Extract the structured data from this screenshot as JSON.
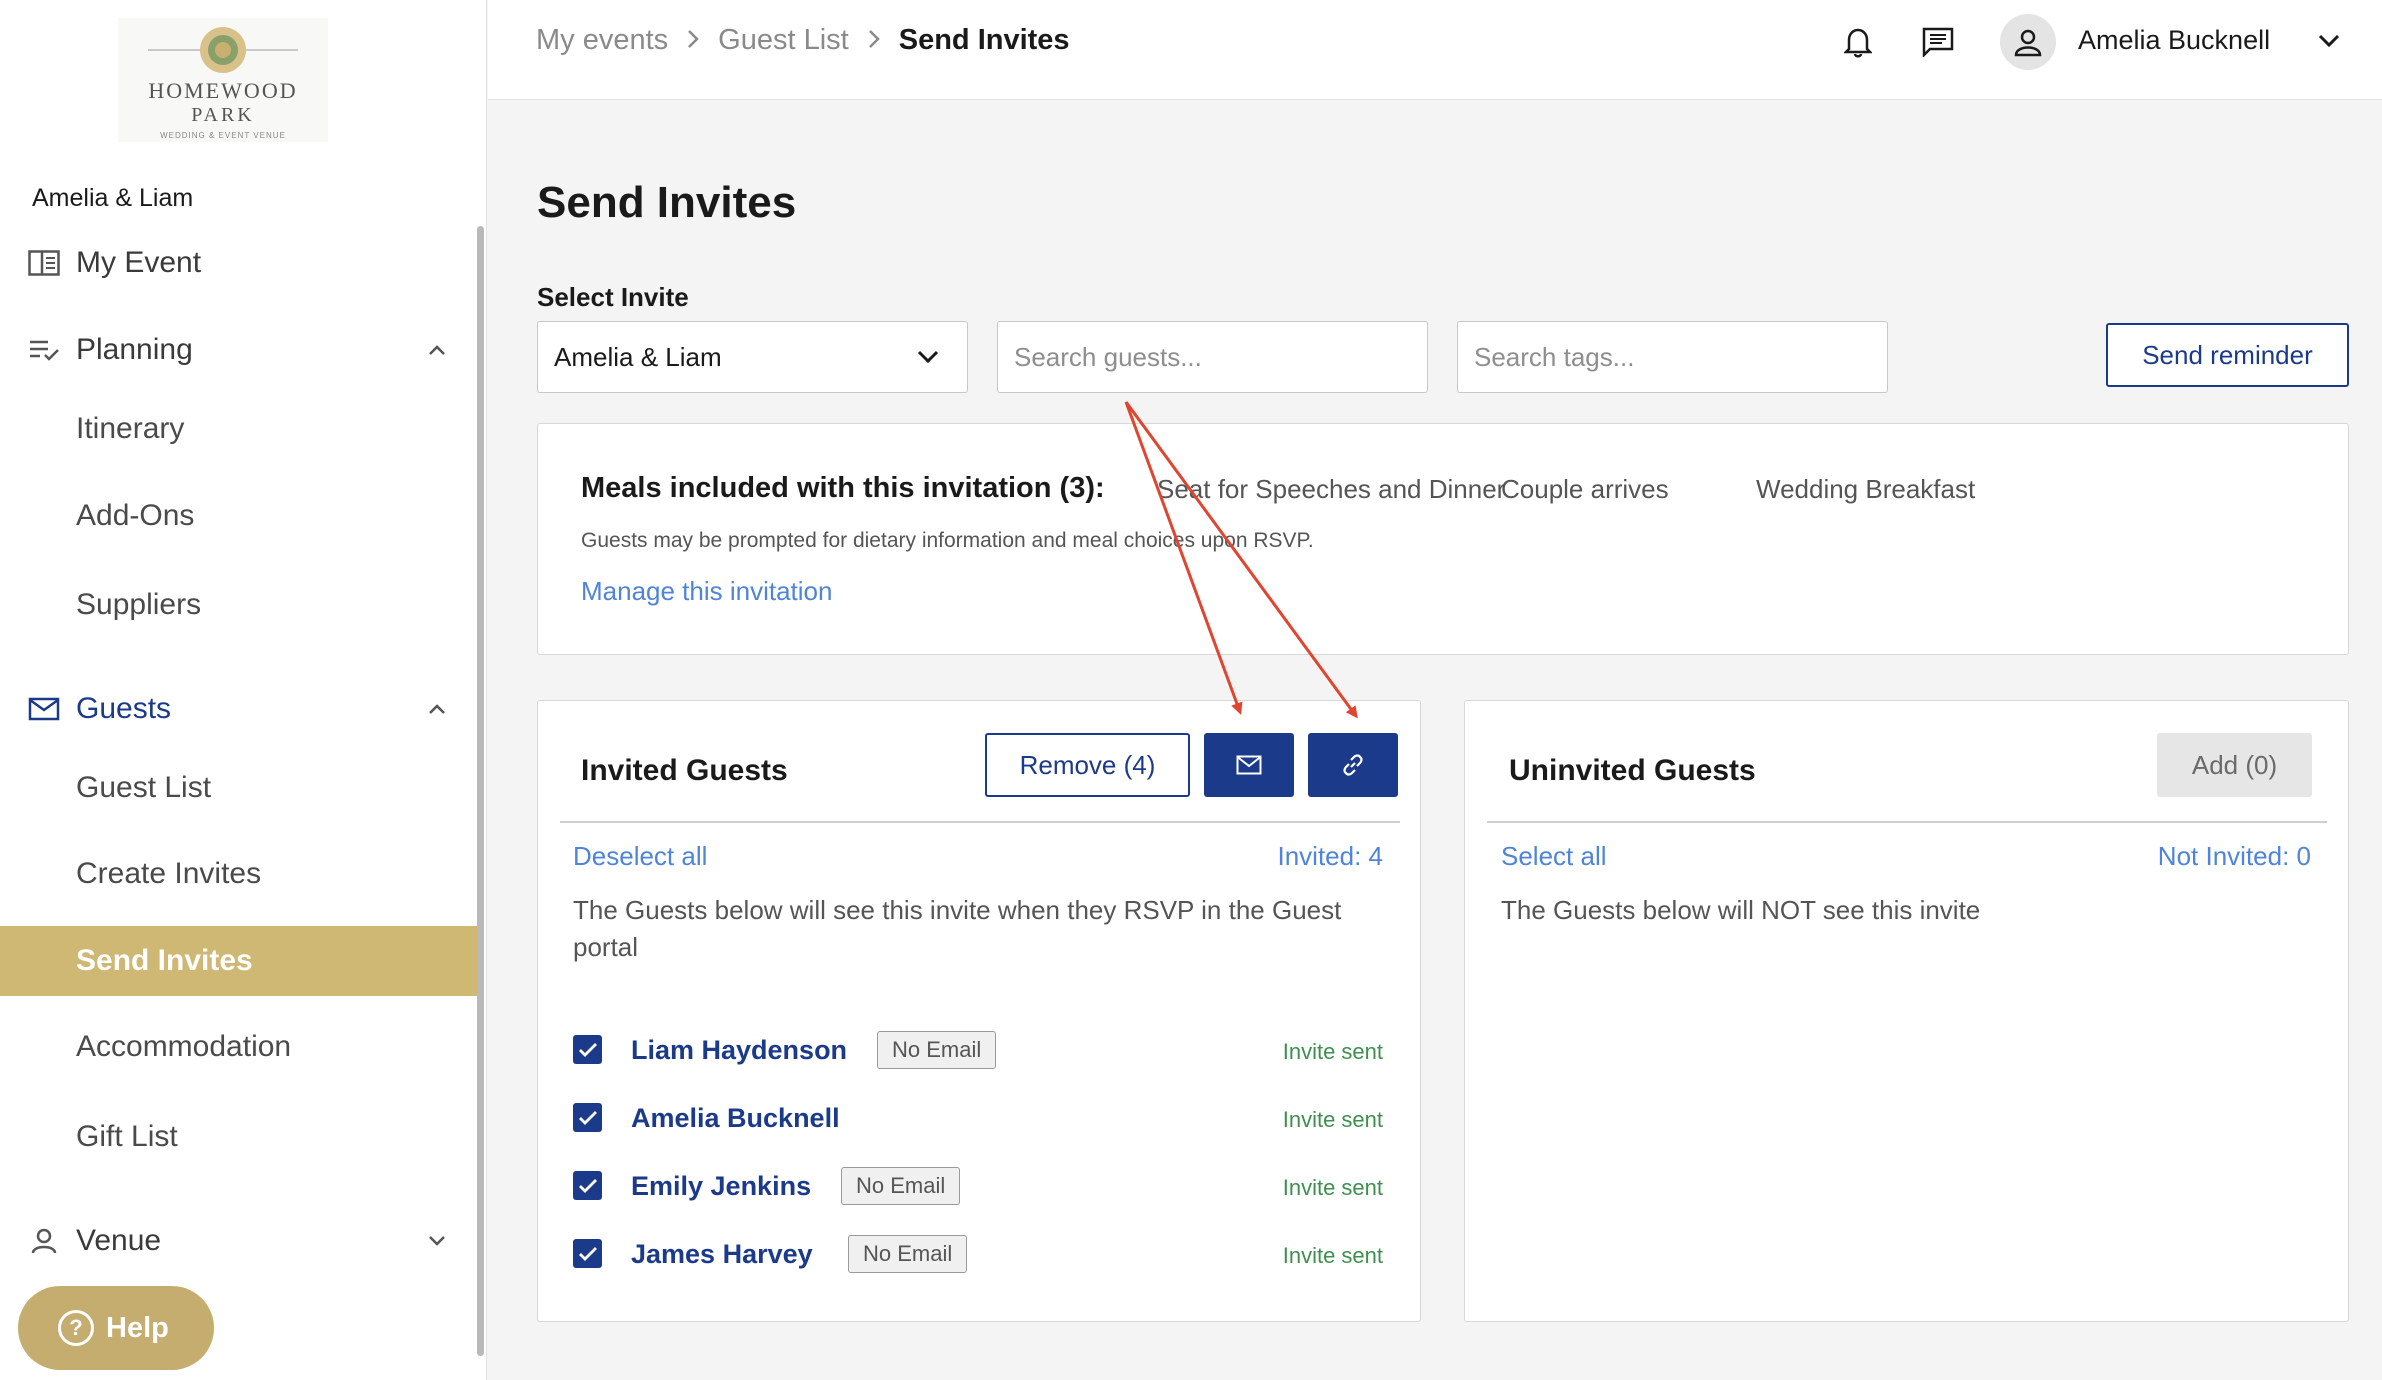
{
  "brand": {
    "logo_line1": "HOMEWOOD",
    "logo_line2": "PARK",
    "logo_line3": "WEDDING & EVENT VENUE"
  },
  "sidebar": {
    "event_name": "Amelia & Liam",
    "items": [
      {
        "label": "My Event",
        "icon": "book-icon"
      },
      {
        "label": "Planning",
        "icon": "checklist-icon"
      },
      {
        "label": "Itinerary"
      },
      {
        "label": "Add-Ons"
      },
      {
        "label": "Suppliers"
      },
      {
        "label": "Guests",
        "icon": "mail-icon"
      },
      {
        "label": "Guest List"
      },
      {
        "label": "Create Invites"
      },
      {
        "label": "Send Invites",
        "active": true
      },
      {
        "label": "Accommodation"
      },
      {
        "label": "Gift List"
      },
      {
        "label": "Venue",
        "icon": "person-icon"
      }
    ],
    "help_label": "Help"
  },
  "topbar": {
    "breadcrumbs": [
      "My events",
      "Guest List",
      "Send Invites"
    ],
    "user_name": "Amelia Bucknell"
  },
  "main": {
    "title": "Send Invites",
    "select_label": "Select Invite",
    "select_value": "Amelia & Liam",
    "search_guests_placeholder": "Search guests...",
    "search_tags_placeholder": "Search tags...",
    "send_reminder_label": "Send reminder"
  },
  "meals": {
    "title": "Meals included with this invitation (3):",
    "tags": [
      "Seat for Speeches and Dinner",
      "Couple arrives",
      "Wedding Breakfast"
    ],
    "note": "Guests may be prompted for dietary information and meal choices upon RSVP.",
    "manage_link": "Manage this invitation"
  },
  "invited": {
    "title": "Invited Guests",
    "remove_label": "Remove (4)",
    "deselect_label": "Deselect all",
    "count_label": "Invited: 4",
    "description": "The Guests below will see this invite when they RSVP in the Guest portal",
    "no_email_label": "No Email",
    "guests": [
      {
        "name": "Liam Haydenson",
        "no_email": true,
        "status": "Invite sent"
      },
      {
        "name": "Amelia Bucknell",
        "no_email": false,
        "status": "Invite sent"
      },
      {
        "name": "Emily Jenkins",
        "no_email": true,
        "status": "Invite sent"
      },
      {
        "name": "James Harvey",
        "no_email": true,
        "status": "Invite sent"
      }
    ]
  },
  "uninvited": {
    "title": "Uninvited Guests",
    "add_label": "Add (0)",
    "select_all_label": "Select all",
    "count_label": "Not Invited: 0",
    "description": "The Guests below will NOT see this invite"
  },
  "colors": {
    "primary": "#1c3a8a",
    "accent_gold": "#cfb873",
    "link": "#4f84d8",
    "success": "#3f8f4f",
    "annotation": "#e0452f"
  }
}
